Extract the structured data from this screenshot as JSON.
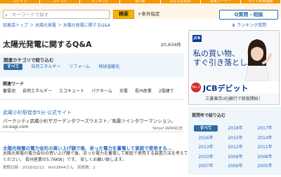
{
  "nav": {
    "items": [
      "ログイン",
      "カテゴリ",
      "ランキング",
      "専門家",
      "みんなの知恵",
      "音楽コーナー",
      "今すぐ利用登録"
    ]
  },
  "search": {
    "placeholder": "キーワードで探す",
    "button": "検索",
    "conditions": "条件指定",
    "question_button": "質問・相談"
  },
  "breadcrumb": {
    "text": "知恵袋トップ ＞ 太陽光発電 ＞ 太陽光発電に関するQ&A"
  },
  "ranking_link": "ランキング質問",
  "page": {
    "title": "太陽光発電に関するQ&A",
    "count": "20,634件"
  },
  "category": {
    "heading": "関連カテゴリで絞り込む",
    "chips": [
      "すべて",
      "自然エネルギー",
      "リフォーム",
      "地球温暖化"
    ],
    "active_index": 0
  },
  "keywords": {
    "heading": "関連ワード",
    "items": [
      "蓄電池",
      "自然エネルギー",
      "エコキュート",
      "パナホーム",
      "充電",
      "長州産業",
      "2階建て"
    ]
  },
  "ad": {
    "title": "武蔵小杉駅徒歩5分-公式サイト",
    "description": "パークシティ武蔵小杉ザガーデンタワーズウエスト／免震ツインタワーマンション。",
    "url": "co-sugi.com",
    "source": "Yahoo! JAPAN広告"
  },
  "qa": {
    "title": "太陽光発電の電力会社の買い上げ額で後、余った電力を蓄電して家庭で使用する...",
    "description": "太陽光発電の電力会社の買い上げ額で後、余った電力を蓄電して家庭で使用する装置方法を考えて\nください。 長州産業の5.76KW」です。 安しくお願い致します。",
    "meta": "質問日時：2018/02/11　tkrh3844さん　回答数：2"
  },
  "banner": {
    "logo": "JCB",
    "copy_line1": "私の買い物、",
    "copy_line2": "すぐ引き落とし。",
    "badge": "No.1",
    "brand": "JCBデビット",
    "footer": "三菱東京UFJ銀行で取扱開始！"
  },
  "years": {
    "heading": "質問年で絞り込む",
    "items": [
      "すべて",
      "2018年",
      "2017年",
      "2016年",
      "2015年",
      "2014年",
      "2013年",
      "2012年",
      "2011年",
      "2010年",
      "2009年",
      "2008年",
      "2007年",
      "2006年",
      "2005年"
    ],
    "active_index": 0
  },
  "colors": {
    "accent": "#f39800",
    "link": "#2a6bc0",
    "active": "#2e6da4"
  }
}
